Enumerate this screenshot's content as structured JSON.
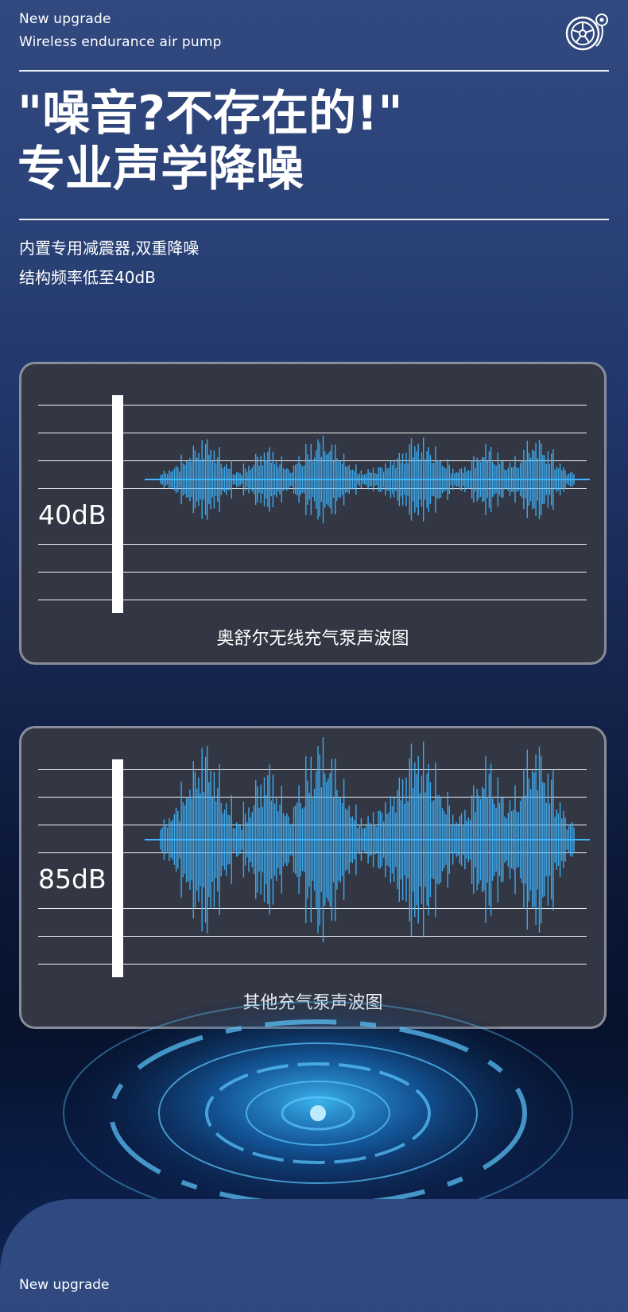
{
  "header": {
    "line1": "New upgrade",
    "line2": "Wireless endurance air pump",
    "logo_icon": "tire-pump-icon"
  },
  "headline": {
    "line1": "\"噪音?不存在的!\"",
    "line2": "专业声学降噪"
  },
  "description": {
    "line1": "内置专用减震器,双重降噪",
    "line2": "结构频率低至40dB"
  },
  "comparison": [
    {
      "level_label": "40dB",
      "caption": "奥舒尔无线充气泵声波图",
      "wave_amplitude": 0.25
    },
    {
      "level_label": "85dB",
      "caption": "其他充气泵声波图",
      "wave_amplitude": 1.0
    }
  ],
  "footer": {
    "partial_text": "New upgrade"
  },
  "colors": {
    "wave": "#3fb6ff",
    "panel_bg": "#333643",
    "panel_border": "#8a8d99"
  }
}
